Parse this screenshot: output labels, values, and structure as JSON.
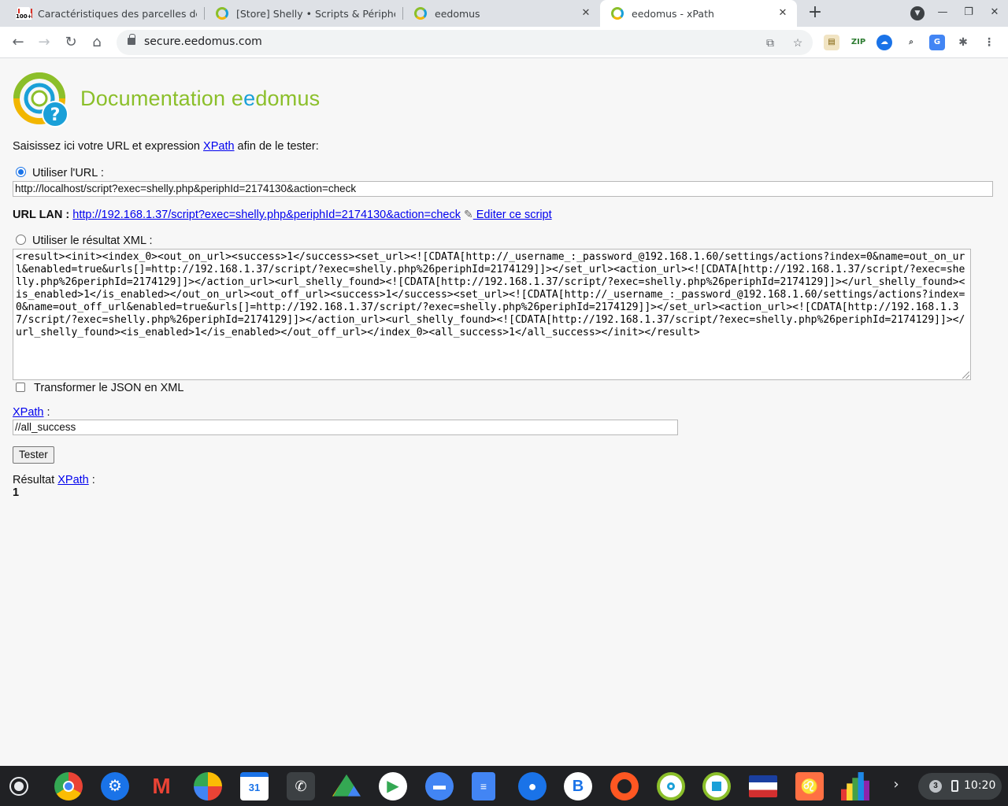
{
  "tabs": [
    {
      "title": "Caractéristiques des parcelles de",
      "favicon": "gmail-icon",
      "active": false
    },
    {
      "title": "[Store] Shelly • Scripts & Périphér",
      "favicon": "eedomus-icon",
      "active": false
    },
    {
      "title": "eedomus",
      "favicon": "eedomus-icon",
      "active": false
    },
    {
      "title": "eedomus - xPath",
      "favicon": "eedomus-icon",
      "active": true
    }
  ],
  "address_bar": {
    "url": "secure.eedomus.com"
  },
  "page": {
    "brand": {
      "title_start": "Documentation e",
      "title_e": "e",
      "title_end": "domus"
    },
    "intro": {
      "before": "Saisissez ici votre URL et expression ",
      "link": "XPath",
      "after": " afin de le tester:"
    },
    "use_url": {
      "label": "Utiliser l'URL :",
      "selected": true,
      "value": "http://localhost/script?exec=shelly.php&periphId=2174130&action=check"
    },
    "url_lan": {
      "label": "URL LAN :",
      "link": "http://192.168.1.37/script?exec=shelly.php&periphId=2174130&action=check",
      "edit_label": " Editer ce script"
    },
    "use_xml": {
      "label": "Utiliser le résultat XML :",
      "selected": false,
      "value": "<result><init><index_0><out_on_url><success>1</success><set_url><![CDATA[http://_username_:_password_@192.168.1.60/settings/actions?index=0&name=out_on_url&enabled=true&urls[]=http://192.168.1.37/script/?exec=shelly.php%26periphId=2174129]]></set_url><action_url><![CDATA[http://192.168.1.37/script/?exec=shelly.php%26periphId=2174129]]></action_url><url_shelly_found><![CDATA[http://192.168.1.37/script/?exec=shelly.php%26periphId=2174129]]></url_shelly_found><is_enabled>1</is_enabled></out_on_url><out_off_url><success>1</success><set_url><![CDATA[http://_username_:_password_@192.168.1.60/settings/actions?index=0&name=out_off_url&enabled=true&urls[]=http://192.168.1.37/script/?exec=shelly.php%26periphId=2174129]]></set_url><action_url><![CDATA[http://192.168.1.37/script/?exec=shelly.php%26periphId=2174129]]></action_url><url_shelly_found><![CDATA[http://192.168.1.37/script/?exec=shelly.php%26periphId=2174129]]></url_shelly_found><is_enabled>1</is_enabled></out_off_url></index_0><all_success>1</all_success></init></result>"
    },
    "json_to_xml": {
      "label": "Transformer le JSON en XML",
      "checked": false
    },
    "xpath": {
      "link": "XPath",
      "suffix": " :",
      "value": "//all_success"
    },
    "test_button": "Tester",
    "result": {
      "prefix": "Résultat ",
      "link": "XPath",
      "suffix": " :",
      "value": "1"
    }
  },
  "taskbar": {
    "apps": [
      "chrome-icon",
      "settings-icon",
      "gmail-icon",
      "photos-icon",
      "calendar-icon",
      "whatsapp-icon",
      "drive-icon",
      "play-store-icon",
      "files-icon",
      "docs-icon",
      "contacts-icon",
      "b-app-icon",
      "firefox-icon",
      "eedomus-icon",
      "eedomus-home-icon",
      "flag-app-icon",
      "lion-app-icon",
      "equalizer-app-icon"
    ],
    "calendar_day": "31",
    "notification_count": "3",
    "time": "10:20"
  },
  "colors": {
    "eedomus_green": "#8bbf2a",
    "eedomus_blue": "#1aa0d8",
    "eedomus_yellow": "#f2b600",
    "link": "#0000ee"
  }
}
